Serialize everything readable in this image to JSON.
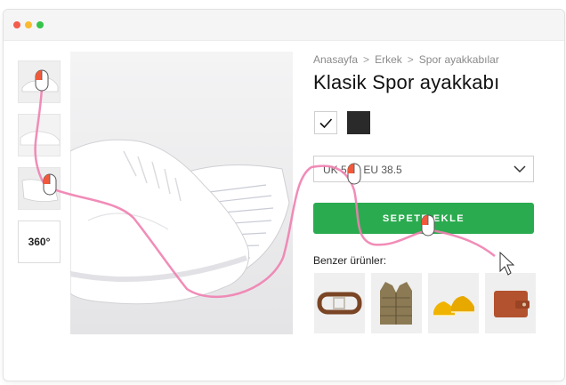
{
  "window": {
    "traffic_lights": [
      "close",
      "minimize",
      "zoom"
    ]
  },
  "gallery": {
    "thumbnails": [
      "shoe-thumbnail-1",
      "shoe-thumbnail-2",
      "shoe-thumbnail-3"
    ],
    "view360_label": "360°"
  },
  "breadcrumb": {
    "items": [
      "Anasayfa",
      "Erkek",
      "Spor ayakkabılar"
    ],
    "separator": ">"
  },
  "product": {
    "title": "Klasik Spor ayakkabı",
    "colors": [
      "#ffffff",
      "#2a2a2a"
    ],
    "selected_color_index": 0,
    "size_value": "UK 5 — EU 38.5",
    "add_to_cart_label": "SEPETE EKLE"
  },
  "similar": {
    "label": "Benzer ürünler:",
    "items": [
      "belt",
      "vest",
      "yellow-sneakers",
      "wallet"
    ]
  },
  "colors": {
    "accent": "#2bab4f",
    "mouse_trail": "#f07fb0",
    "click_marker": "#f05a3c"
  }
}
